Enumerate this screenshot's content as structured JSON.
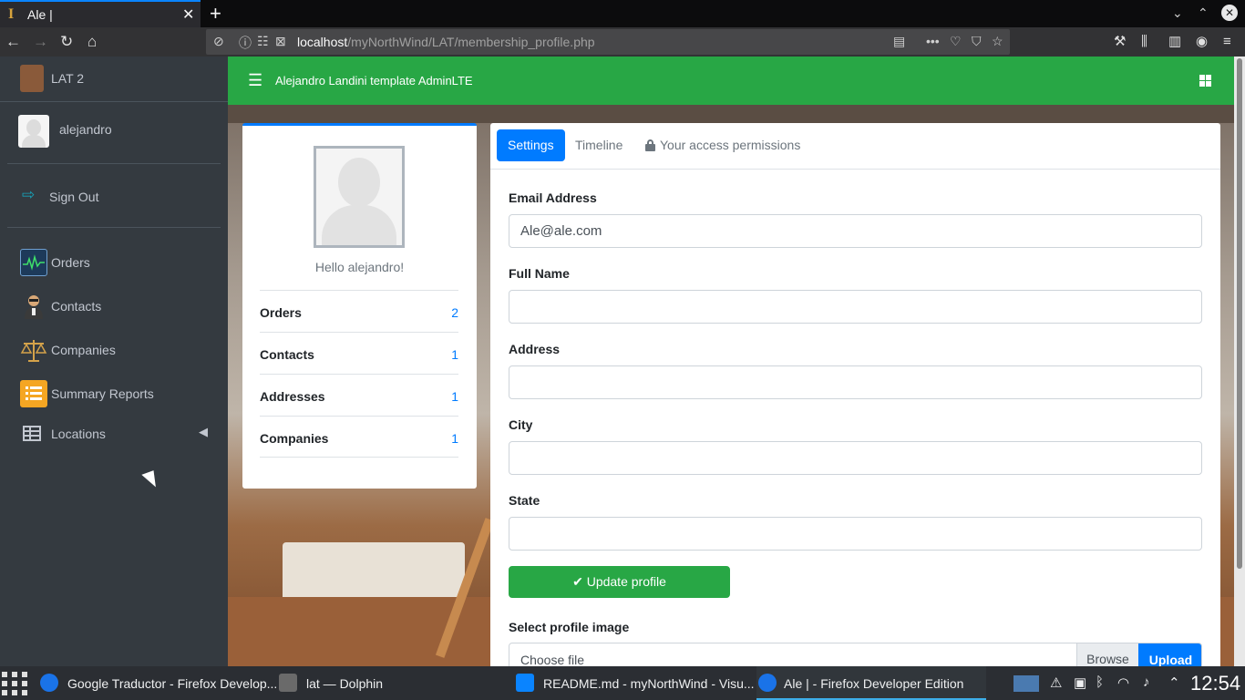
{
  "browser": {
    "tab_title": "Ale |",
    "tab_close": "✕",
    "new_tab": "+",
    "url_host": "localhost",
    "url_path": "/myNorthWind/LAT/membership_profile.php"
  },
  "sidebar": {
    "brand": "LAT 2",
    "username": "alejandro",
    "signout": "Sign Out",
    "items": [
      {
        "label": "Orders",
        "icon": "orders-icon"
      },
      {
        "label": "Contacts",
        "icon": "contacts-icon"
      },
      {
        "label": "Companies",
        "icon": "companies-icon"
      },
      {
        "label": "Summary Reports",
        "icon": "summary-reports-icon"
      },
      {
        "label": "Locations",
        "icon": "table-icon"
      }
    ]
  },
  "header": {
    "title": "Alejandro Landini template AdminLTE"
  },
  "profile": {
    "greeting": "Hello alejandro!",
    "stats": [
      {
        "label": "Orders",
        "value": "2"
      },
      {
        "label": "Contacts",
        "value": "1"
      },
      {
        "label": "Addresses",
        "value": "1"
      },
      {
        "label": "Companies",
        "value": "1"
      }
    ]
  },
  "settings": {
    "tabs": [
      "Settings",
      "Timeline",
      "Your access permissions"
    ],
    "active_tab": "Settings",
    "fields": [
      {
        "label": "Email Address",
        "value": "Ale@ale.com"
      },
      {
        "label": "Full Name",
        "value": ""
      },
      {
        "label": "Address",
        "value": ""
      },
      {
        "label": "City",
        "value": ""
      },
      {
        "label": "State",
        "value": ""
      }
    ],
    "update_button": "✔ Update profile",
    "image_label": "Select profile image",
    "file_placeholder": "Choose file",
    "browse": "Browse",
    "upload": "Upload"
  },
  "taskbar": {
    "tasks": [
      {
        "label": "Google Traductor - Firefox Develop..."
      },
      {
        "label": "lat — Dolphin"
      },
      {
        "label": "README.md - myNorthWind - Visu..."
      },
      {
        "label": "Ale | - Firefox Developer Edition"
      }
    ],
    "clock": "12:54"
  },
  "colors": {
    "header_green": "#28a745",
    "sidebar_dark": "#343a40",
    "primary_blue": "#007bff"
  }
}
